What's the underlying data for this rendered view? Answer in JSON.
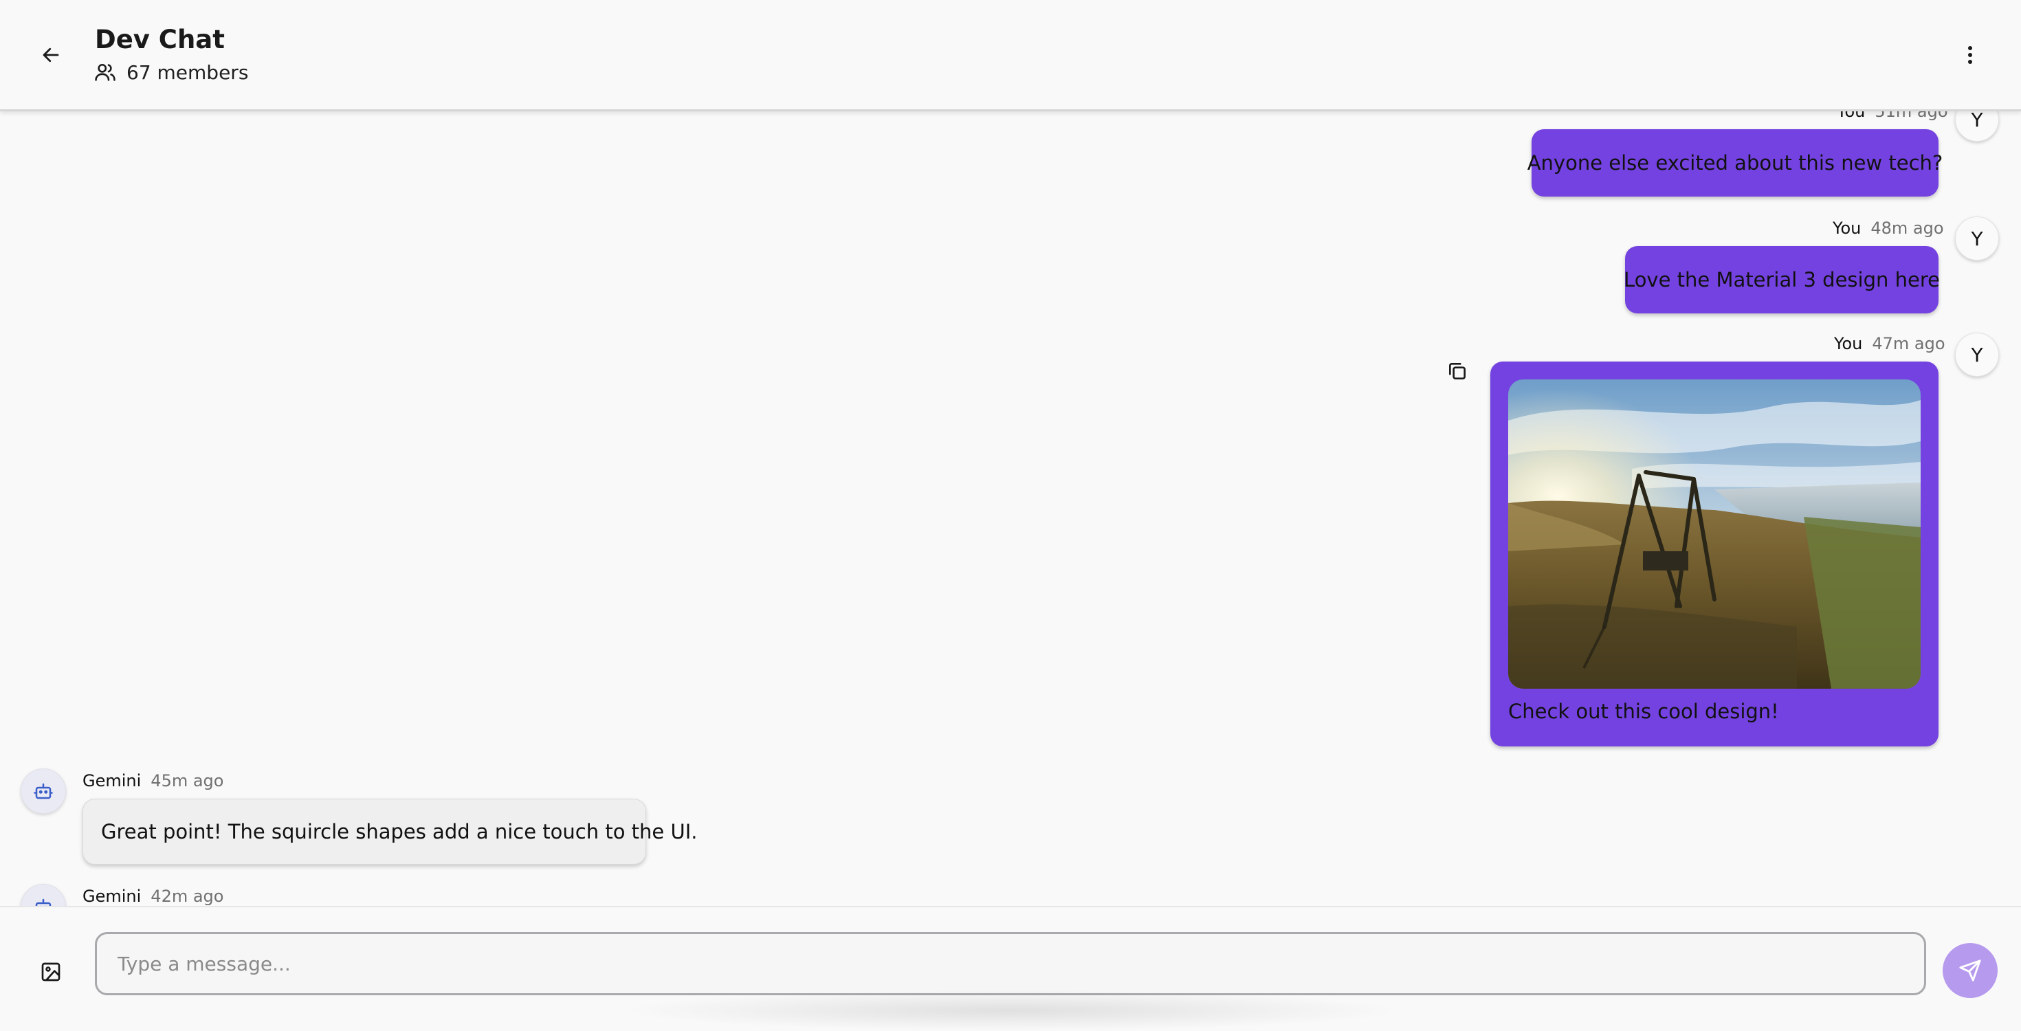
{
  "header": {
    "title": "Dev Chat",
    "members": "67 members",
    "back_icon": "arrow-left-icon",
    "members_icon": "users-icon",
    "menu_icon": "more-vertical-icon"
  },
  "messages": [
    {
      "sender": "You",
      "time": "51m ago",
      "text": "Anyone else excited about this new tech?",
      "avatar": "Y"
    },
    {
      "sender": "You",
      "time": "48m ago",
      "text": "Love the Material 3 design here",
      "avatar": "Y"
    },
    {
      "sender": "You",
      "time": "47m ago",
      "text": "Check out this cool design!",
      "avatar": "Y",
      "image": "landscape-photo-with-swing"
    },
    {
      "sender": "Gemini",
      "time": "45m ago",
      "text": "Great point! The squircle shapes add a nice touch to the UI.",
      "avatar_icon": "robot-icon"
    },
    {
      "sender": "Gemini",
      "time": "42m ago",
      "avatar_icon": "robot-icon"
    }
  ],
  "composer": {
    "placeholder": "Type a message...",
    "attach_icon": "image-icon",
    "send_icon": "send-icon"
  },
  "colors": {
    "outgoing_bubble": "#7442e0",
    "incoming_bubble": "#efefef",
    "send_button": "#b69aee",
    "background": "#f9f9f9"
  }
}
